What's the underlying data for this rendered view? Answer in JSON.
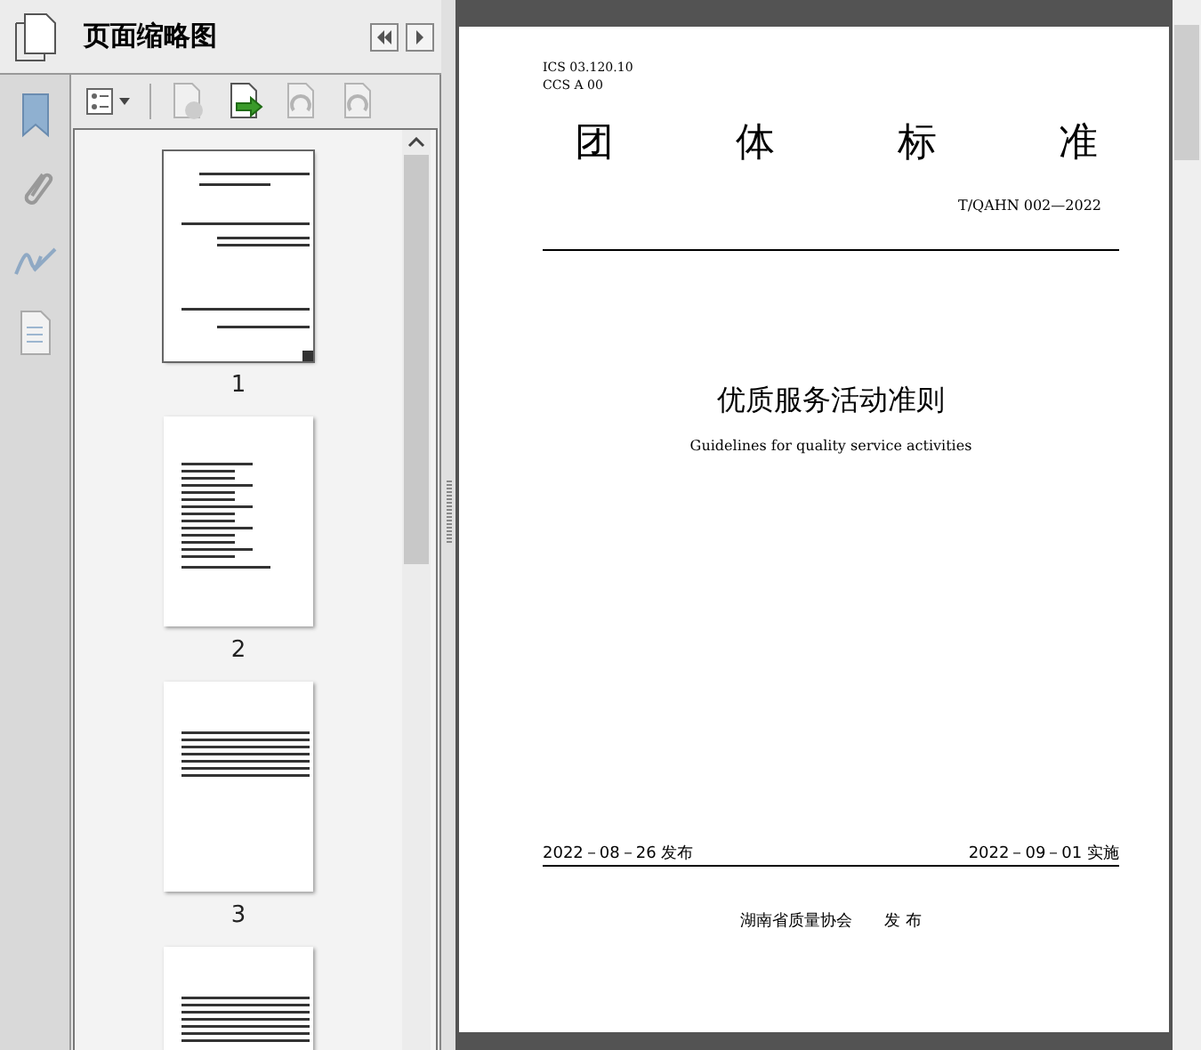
{
  "panel": {
    "title": "页面缩略图"
  },
  "toolbar": [
    {
      "kind": "options",
      "disabled": false
    },
    {
      "kind": "delete",
      "disabled": true
    },
    {
      "kind": "insert",
      "disabled": false
    },
    {
      "kind": "rotate-left",
      "disabled": true
    },
    {
      "kind": "rotate-right",
      "disabled": true
    }
  ],
  "thumbnails": [
    {
      "label": "1",
      "selected": true,
      "kind": "cover"
    },
    {
      "label": "2",
      "selected": false,
      "kind": "toc"
    },
    {
      "label": "3",
      "selected": false,
      "kind": "text"
    },
    {
      "selected": false,
      "kind": "text"
    }
  ],
  "document": {
    "ics": "ICS  03.120.10",
    "ccs": "CCS  A 00",
    "heading": [
      "团",
      "体",
      "标",
      "准"
    ],
    "code": "T/QAHN 002—2022",
    "title": "优质服务活动准则",
    "subtitle": "Guidelines for quality service activities",
    "issued": "2022－08－26 发布",
    "effective": "2022－09－01 实施",
    "publisher": "湖南省质量协会",
    "publish_word": "发  布"
  }
}
